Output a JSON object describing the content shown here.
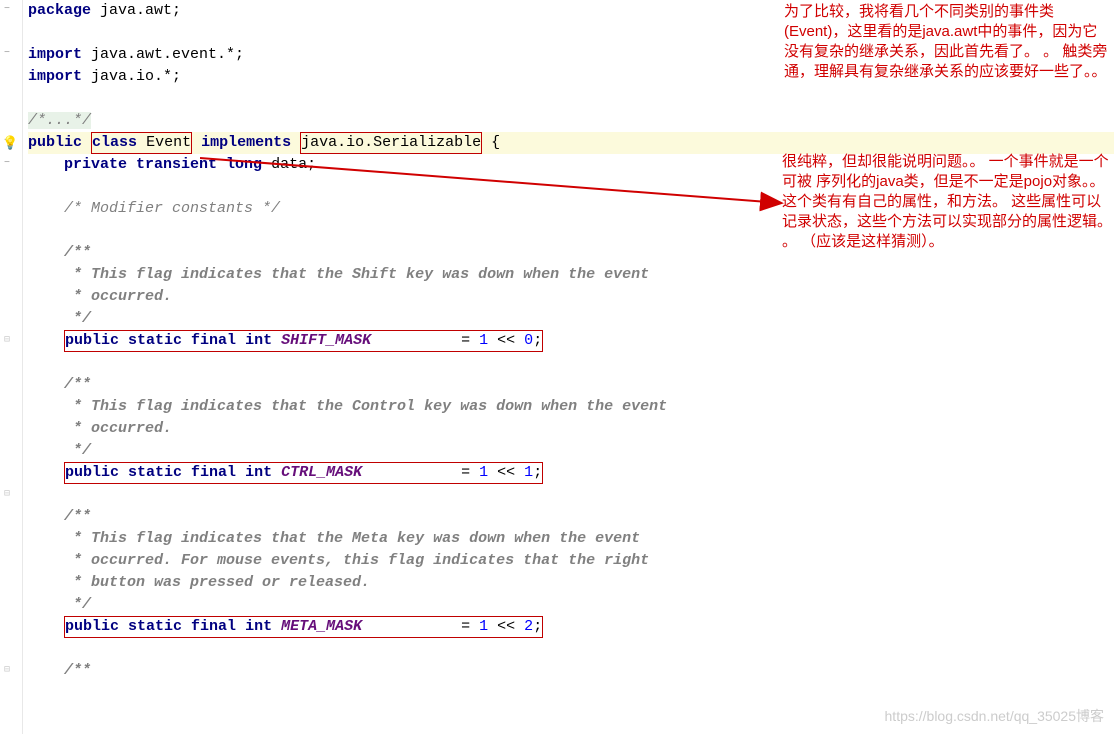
{
  "code": {
    "pkg_kw": "package",
    "pkg_name": " java.awt;",
    "import_kw": "import",
    "import1": " java.awt.event.*;",
    "import2": " java.io.*;",
    "fold": "/*...*/",
    "class_public": "public",
    "class_class": "class",
    "class_name": "Event",
    "class_implements": "implements",
    "class_iface": "java.io.Serializable",
    "class_brace": " {",
    "field_line_pre": "    ",
    "field_private": "private",
    "field_transient": " transient",
    "field_long": " long",
    "field_name": " data",
    "field_semi": ";",
    "mod_comment": "    /* Modifier constants */",
    "doc1_l1": "    /**",
    "doc1_l2": "     * This flag indicates that the Shift key was down when the event",
    "doc1_l3": "     * occurred.",
    "doc1_l4": "     */",
    "const1_pre": "    ",
    "const_public": "public",
    "const_static": " static",
    "const_final": " final",
    "const_int": " int",
    "const1_name": " SHIFT_MASK",
    "const1_pad": "          ",
    "eq": "= ",
    "one": "1",
    "lshift": " << ",
    "zero": "0",
    "semi": ";",
    "doc2_l1": "    /**",
    "doc2_l2": "     * This flag indicates that the Control key was down when the event",
    "doc2_l3": "     * occurred.",
    "doc2_l4": "     */",
    "const2_name": " CTRL_MASK",
    "const2_pad": "           ",
    "doc3_l1": "    /**",
    "doc3_l2": "     * This flag indicates that the Meta key was down when the event",
    "doc3_l3": "     * occurred. For mouse events, this flag indicates that the right",
    "doc3_l4": "     * button was pressed or released.",
    "doc3_l5": "     */",
    "const3_name": " META_MASK",
    "const3_pad": "           ",
    "two": "2",
    "trail_doc": "    /**"
  },
  "annotations": {
    "top": "为了比较，我将看几个不同类别的事件类(Event)，这里看的是java.awt中的事件，因为它没有复杂的继承关系，因此首先看了。 。   触类旁通，理解具有复杂继承关系的应该要好一些了。。",
    "mid": "    很纯粹，但却很能说明问题。。    一个事件就是一个可被 序列化的java类，但是不一定是pojo对象。。\n   这个类有有自己的属性，和方法。   这些属性可以记录状态，这些个方法可以实现部分的属性逻辑。 。 （应该是这样猜测）。"
  },
  "watermark": "https://blog.csdn.net/qq_35025博客"
}
